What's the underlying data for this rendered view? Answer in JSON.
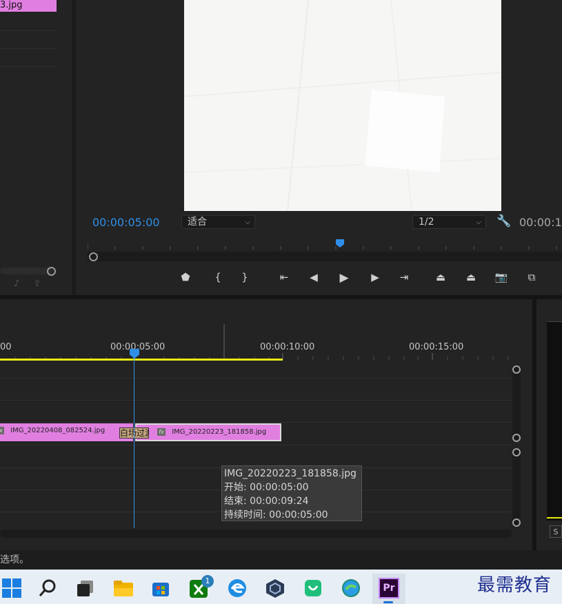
{
  "project": {
    "selected_item": "3.jpg",
    "footer_icons": [
      "♪",
      "⇪"
    ]
  },
  "monitor": {
    "timecode": "00:00:05:00",
    "fit_label": "适合",
    "resolution_label": "1/2",
    "timecode_right": "00:00:1",
    "accent_color": "#2f8fe8"
  },
  "timeline": {
    "ruler_labels": [
      "00",
      "00:00:05:00",
      "00:00:10:00",
      "00:00:15:00"
    ],
    "clip1_label": "IMG_20220408_082524.jpg",
    "clip2_label": "IMG_20220223_181858.jpg",
    "fx_label": "fx",
    "transition_label": "白场过渡",
    "clip_color": "#e17fe1",
    "workarea_color": "#e9e914"
  },
  "tooltip": {
    "title": "IMG_20220223_181858.jpg",
    "start": "开始: 00:00:05:00",
    "end": "结束: 00:00:09:24",
    "duration": "持续时间: 00:00:05:00"
  },
  "meters": {
    "solo_label": "S"
  },
  "status_bar": {
    "text": "选项。"
  },
  "taskbar": {
    "icons": [
      "windows-start-icon",
      "search-icon",
      "task-view-icon",
      "file-explorer-icon",
      "store-icon",
      "xbox-icon",
      "edge-legacy-icon",
      "virtualbox-icon",
      "shopping-icon",
      "edge-icon",
      "premiere-pro-icon"
    ],
    "xbox_badge": "1",
    "premiere_label": "Pr"
  },
  "watermark": "最需教育"
}
